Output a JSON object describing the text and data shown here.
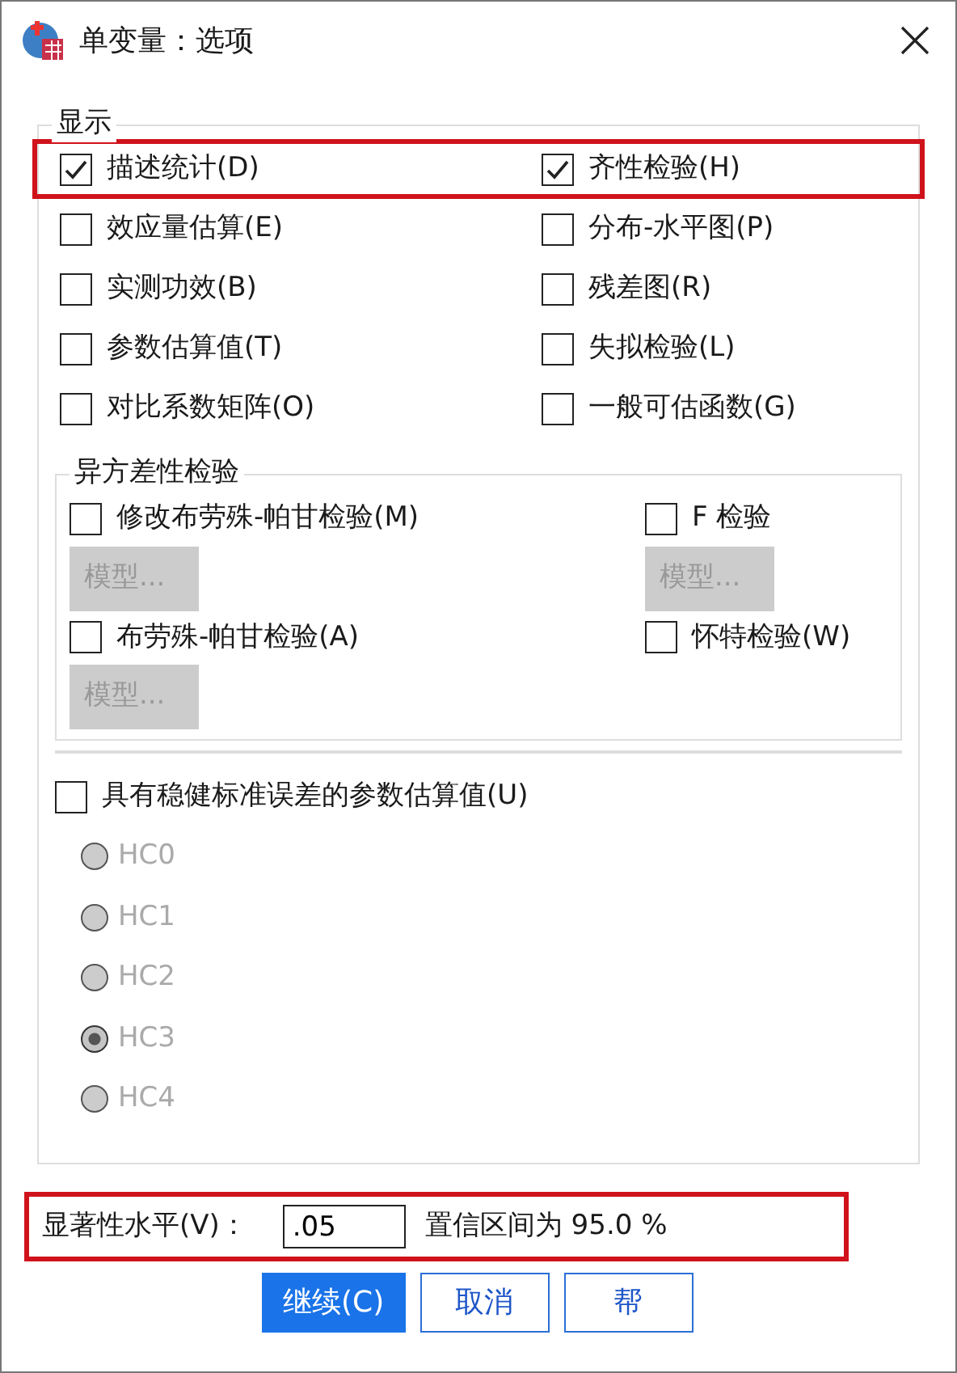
{
  "window": {
    "title": "单变量：选项"
  },
  "display": {
    "title": "显示",
    "rows": [
      {
        "highlighted": true,
        "items": [
          {
            "label": "描述统计(D)",
            "checked": true
          },
          {
            "label": "齐性检验(H)",
            "checked": true
          }
        ]
      },
      {
        "highlighted": false,
        "items": [
          {
            "label": "效应量估算(E)",
            "checked": false
          },
          {
            "label": "分布-水平图(P)",
            "checked": false
          }
        ]
      },
      {
        "highlighted": false,
        "items": [
          {
            "label": "实测功效(B)",
            "checked": false
          },
          {
            "label": "残差图(R)",
            "checked": false
          }
        ]
      },
      {
        "highlighted": false,
        "items": [
          {
            "label": "参数估算值(T)",
            "checked": false
          },
          {
            "label": "失拟检验(L)",
            "checked": false
          }
        ]
      },
      {
        "highlighted": false,
        "items": [
          {
            "label": "对比系数矩阵(O)",
            "checked": false
          },
          {
            "label": "一般可估函数(G)",
            "checked": false
          }
        ]
      }
    ]
  },
  "heteroscedasticity": {
    "title": "异方差性检验",
    "tests": [
      {
        "label": "修改布劳殊-帕甘检验(M)",
        "checked": false,
        "model_button": {
          "label": "模型...",
          "disabled": true
        }
      },
      {
        "label": "F 检验",
        "checked": false,
        "model_button": {
          "label": "模型...",
          "disabled": true
        }
      },
      {
        "label": "布劳殊-帕甘检验(A)",
        "checked": false,
        "model_button": {
          "label": "模型...",
          "disabled": true
        }
      },
      {
        "label": "怀特检验(W)",
        "checked": false
      }
    ]
  },
  "robust": {
    "label": "具有稳健标准误差的参数估算值(U)",
    "checked": false,
    "options": [
      {
        "label": "HC0",
        "selected": false,
        "disabled": true
      },
      {
        "label": "HC1",
        "selected": false,
        "disabled": true
      },
      {
        "label": "HC2",
        "selected": false,
        "disabled": true
      },
      {
        "label": "HC3",
        "selected": true,
        "disabled": true
      },
      {
        "label": "HC4",
        "selected": false,
        "disabled": true
      }
    ]
  },
  "significance": {
    "label": "显著性水平(V)：",
    "value": ".05",
    "note": "置信区间为 95.0 %",
    "highlighted": true
  },
  "buttons": [
    {
      "label": "继续(C)",
      "primary": true
    },
    {
      "label": "取消",
      "primary": false
    },
    {
      "label": "帮",
      "primary": false
    }
  ]
}
